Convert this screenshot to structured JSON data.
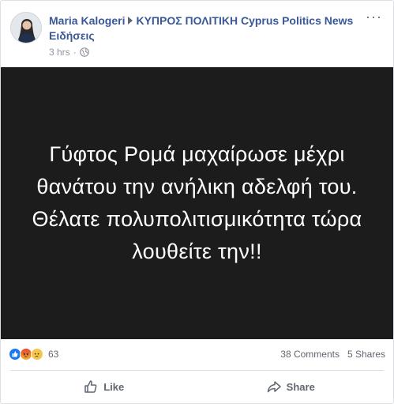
{
  "post": {
    "author": "Maria Kalogeri",
    "page": "ΚΥΠΡΟΣ ΠΟΛΙΤΙΚΗ Cyprus Politics News Ειδήσεις",
    "time": "3 hrs",
    "separator": "·",
    "more_icon": "more-options-icon",
    "audience_icon": "globe-icon",
    "image_text": "Γύφτος Ρομά μαχαίρωσε μέχρι θανάτου την ανήλικη αδελφή του. Θέλατε πολυπολιτισμικότητα τώρα λουθείτε την!!"
  },
  "reactions": {
    "icons": [
      "like-reaction-icon",
      "angry-reaction-icon",
      "sad-reaction-icon"
    ],
    "count": "63",
    "comments": "38 Comments",
    "shares": "5 Shares"
  },
  "actions": {
    "like_label": "Like",
    "share_label": "Share"
  },
  "colors": {
    "link": "#385898",
    "muted": "#606770",
    "image_bg": "#1c1c1c",
    "like_blue": "#1877f2",
    "angry_orange": "#f0553a",
    "sad_yellow": "#f7b125"
  }
}
